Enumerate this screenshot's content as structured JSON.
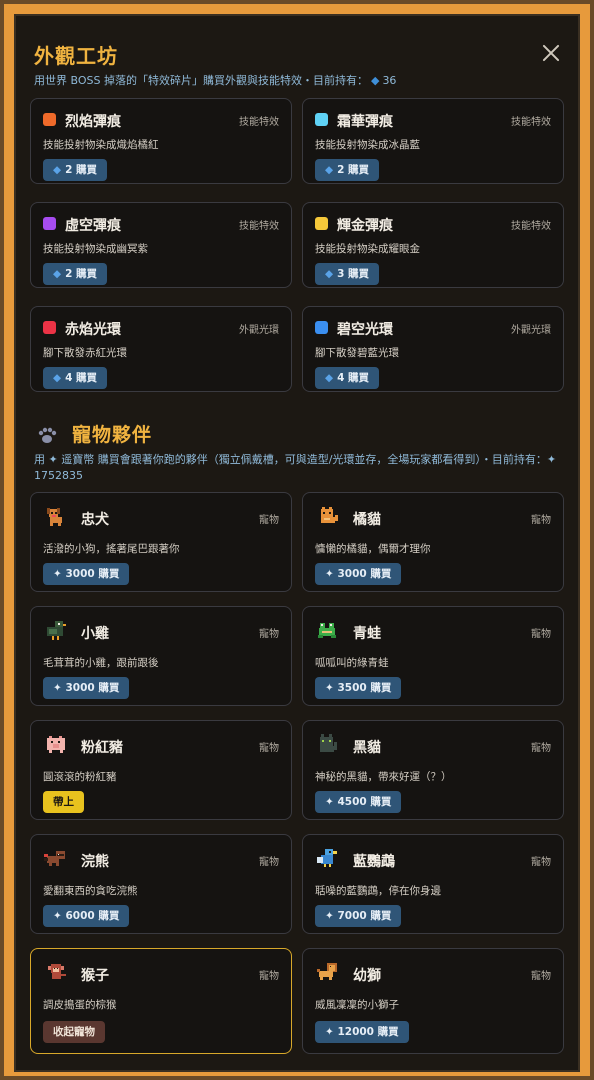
{
  "header": {
    "title": "外觀工坊",
    "subtitle_pre": "用世界 BOSS 掉落的「特效碎片」購買外觀與技能特效・目前持有：",
    "shards": "36"
  },
  "effects": [
    {
      "name": "烈焰彈痕",
      "tag": "技能特效",
      "desc": "技能投射物染成熾焰橘紅",
      "price": "2 購買",
      "color": "#ef6a2a"
    },
    {
      "name": "霜華彈痕",
      "tag": "技能特效",
      "desc": "技能投射物染成冰晶藍",
      "price": "2 購買",
      "color": "#5fd2f5"
    },
    {
      "name": "虛空彈痕",
      "tag": "技能特效",
      "desc": "技能投射物染成幽冥紫",
      "price": "2 購買",
      "color": "#a64cf0"
    },
    {
      "name": "輝金彈痕",
      "tag": "技能特效",
      "desc": "技能投射物染成耀眼金",
      "price": "3 購買",
      "color": "#f5c83a"
    },
    {
      "name": "赤焰光環",
      "tag": "外觀光環",
      "desc": "腳下散發赤紅光環",
      "price": "4 購買",
      "color": "#ec3346"
    },
    {
      "name": "碧空光環",
      "tag": "外觀光環",
      "desc": "腳下散發碧藍光環",
      "price": "4 購買",
      "color": "#3b8ff0"
    }
  ],
  "pets_section": {
    "title": "寵物夥伴",
    "desc": "用 ✦ 遥寶幣 購買會跟著你跑的夥伴（獨立佩戴槽，可與造型/光環並存，全場玩家都看得到）・目前持有：✦ 1752835"
  },
  "pets": [
    {
      "name": "忠犬",
      "tag": "寵物",
      "desc": "活潑的小狗，搖著尾巴跟著你",
      "action": "✦ 3000 購買",
      "state": "buy",
      "icon": "dog-icon"
    },
    {
      "name": "橘貓",
      "tag": "寵物",
      "desc": "慵懶的橘貓，偶爾才理你",
      "action": "✦ 3000 購買",
      "state": "buy",
      "icon": "orange-cat-icon"
    },
    {
      "name": "小雞",
      "tag": "寵物",
      "desc": "毛茸茸的小雞，跟前跟後",
      "action": "✦ 3000 購買",
      "state": "buy",
      "icon": "chick-icon"
    },
    {
      "name": "青蛙",
      "tag": "寵物",
      "desc": "呱呱叫的綠青蛙",
      "action": "✦ 3500 購買",
      "state": "buy",
      "icon": "frog-icon"
    },
    {
      "name": "粉紅豬",
      "tag": "寵物",
      "desc": "圓滾滾的粉紅豬",
      "action": "帶上",
      "state": "equip",
      "icon": "pig-icon"
    },
    {
      "name": "黑貓",
      "tag": "寵物",
      "desc": "神秘的黑貓，帶來好運（？）",
      "action": "✦ 4500 購買",
      "state": "buy",
      "icon": "black-cat-icon"
    },
    {
      "name": "浣熊",
      "tag": "寵物",
      "desc": "愛翻東西的貪吃浣熊",
      "action": "✦ 6000 購買",
      "state": "buy",
      "icon": "raccoon-icon"
    },
    {
      "name": "藍鸚鵡",
      "tag": "寵物",
      "desc": "聒噪的藍鸚鵡，停在你身邊",
      "action": "✦ 7000 購買",
      "state": "buy",
      "icon": "parrot-icon"
    },
    {
      "name": "猴子",
      "tag": "寵物",
      "desc": "調皮搗蛋的棕猴",
      "action": "收起寵物",
      "state": "stow",
      "icon": "monkey-icon"
    },
    {
      "name": "幼獅",
      "tag": "寵物",
      "desc": "威風凜凜的小獅子",
      "action": "✦ 12000 購買",
      "state": "buy",
      "icon": "lion-cub-icon"
    }
  ]
}
